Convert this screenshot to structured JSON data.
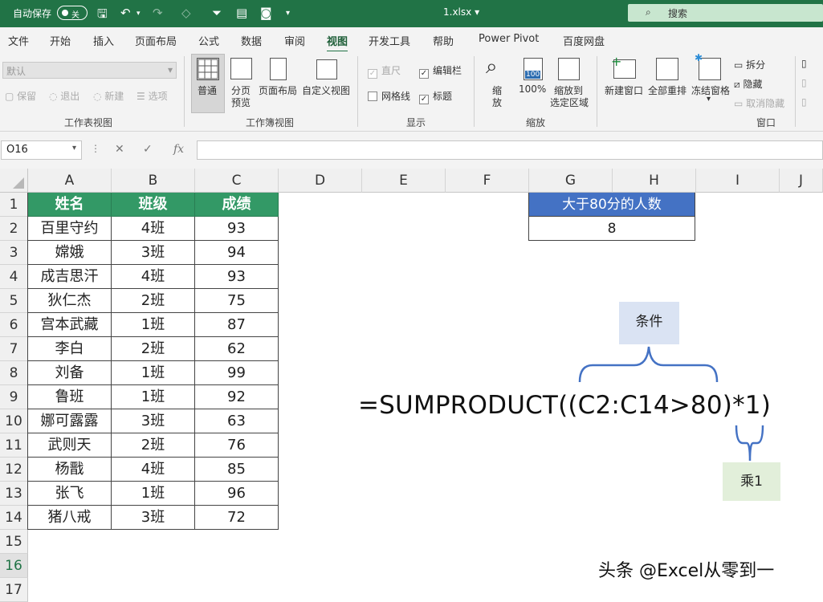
{
  "titlebar": {
    "autosave_label": "自动保存",
    "autosave_state": "关",
    "filename": "1.xlsx",
    "search_placeholder": "搜索"
  },
  "tabs": [
    "文件",
    "开始",
    "插入",
    "页面布局",
    "公式",
    "数据",
    "审阅",
    "视图",
    "开发工具",
    "帮助",
    "Power Pivot",
    "百度网盘"
  ],
  "active_tab": "视图",
  "ribbon": {
    "sheet_view": {
      "dropdown_value": "默认",
      "keep": "保留",
      "exit": "退出",
      "new": "新建",
      "options": "选项",
      "label": "工作表视图"
    },
    "workbook_view": {
      "normal": "普通",
      "page_break_1": "分页",
      "page_break_2": "预览",
      "page_layout": "页面布局",
      "custom_view": "自定义视图",
      "label": "工作簿视图"
    },
    "show": {
      "ruler": "直尺",
      "formula_bar": "编辑栏",
      "gridlines": "网格线",
      "headings": "标题",
      "label": "显示"
    },
    "zoom": {
      "zoom_1": "缩",
      "zoom_2": "放",
      "hundred": "100%",
      "fit_1": "缩放到",
      "fit_2": "选定区域",
      "label": "缩放",
      "icon_value": "100"
    },
    "window": {
      "new_window": "新建窗口",
      "arrange_all": "全部重排",
      "freeze": "冻结窗格",
      "split": "拆分",
      "hide": "隐藏",
      "unhide": "取消隐藏",
      "label": "窗口"
    }
  },
  "formula_bar": {
    "name_box": "O16",
    "fx": "fx",
    "content": ""
  },
  "columns": [
    "A",
    "B",
    "C",
    "D",
    "E",
    "F",
    "G",
    "H",
    "I",
    "J"
  ],
  "rows": [
    "1",
    "2",
    "3",
    "4",
    "5",
    "6",
    "7",
    "8",
    "9",
    "10",
    "11",
    "12",
    "13",
    "14",
    "15",
    "16",
    "17"
  ],
  "table": {
    "headers": [
      "姓名",
      "班级",
      "成绩"
    ],
    "rows": [
      [
        "百里守约",
        "4班",
        "93"
      ],
      [
        "嫦娥",
        "3班",
        "94"
      ],
      [
        "成吉思汗",
        "4班",
        "93"
      ],
      [
        "狄仁杰",
        "2班",
        "75"
      ],
      [
        "宫本武藏",
        "1班",
        "87"
      ],
      [
        "李白",
        "2班",
        "62"
      ],
      [
        "刘备",
        "1班",
        "99"
      ],
      [
        "鲁班",
        "1班",
        "92"
      ],
      [
        "娜可露露",
        "3班",
        "63"
      ],
      [
        "武则天",
        "2班",
        "76"
      ],
      [
        "杨戬",
        "4班",
        "85"
      ],
      [
        "张飞",
        "1班",
        "96"
      ],
      [
        "猪八戒",
        "3班",
        "72"
      ]
    ]
  },
  "result": {
    "header": "大于80分的人数",
    "value": "8"
  },
  "annotation": {
    "formula": "=SUMPRODUCT((C2:C14>80)*1)",
    "condition_label": "条件",
    "multiply_label": "乘1"
  },
  "watermark": "头条 @Excel从零到一",
  "colors": {
    "excel_green": "#217346",
    "table_header": "#339966",
    "result_header": "#4472c4",
    "condition_box": "#dae3f3",
    "multiply_box": "#e2efda",
    "brace": "#4472c4"
  }
}
